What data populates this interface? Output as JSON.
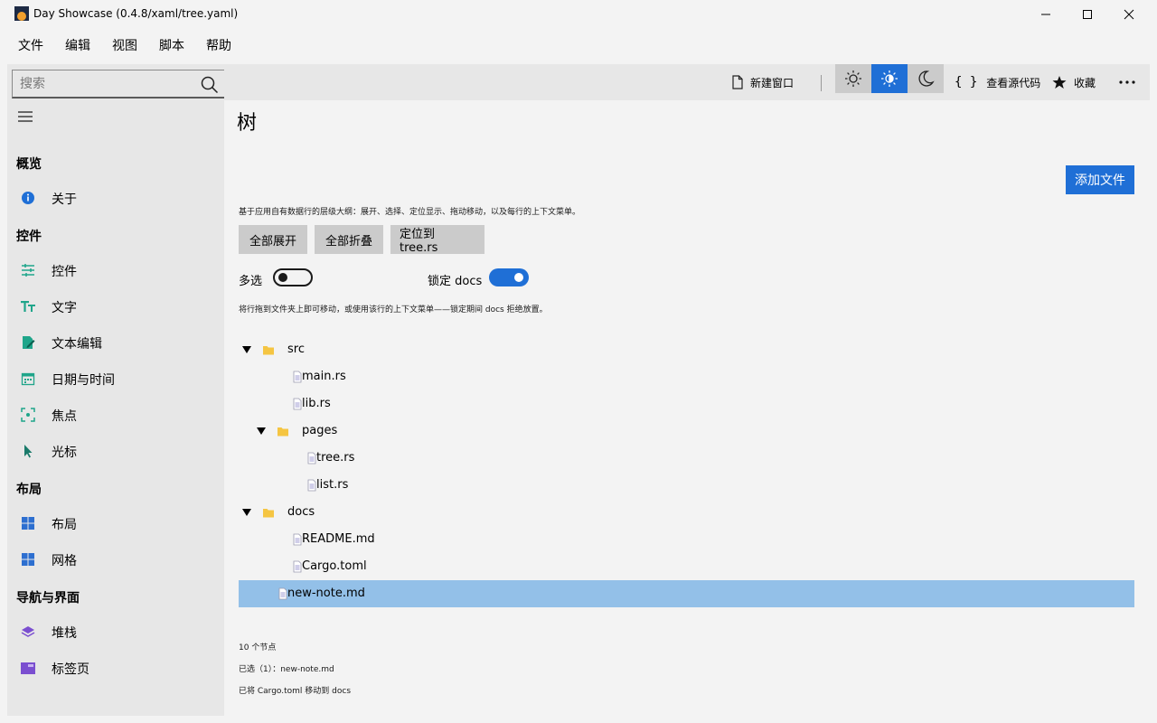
{
  "window": {
    "title": "Day Showcase (0.4.8/xaml/tree.yaml)"
  },
  "menu": [
    "文件",
    "编辑",
    "视图",
    "脚本",
    "帮助"
  ],
  "sidebar": {
    "search_placeholder": "搜索",
    "sections": [
      {
        "title": "概览",
        "items": [
          {
            "label": "关于",
            "icon": "info-icon"
          }
        ]
      },
      {
        "title": "控件",
        "items": [
          {
            "label": "控件",
            "icon": "sliders-icon"
          },
          {
            "label": "文字",
            "icon": "text-icon"
          },
          {
            "label": "文本编辑",
            "icon": "edit-icon"
          },
          {
            "label": "日期与时间",
            "icon": "calendar-icon"
          },
          {
            "label": "焦点",
            "icon": "focus-icon"
          },
          {
            "label": "光标",
            "icon": "cursor-icon"
          }
        ]
      },
      {
        "title": "布局",
        "items": [
          {
            "label": "布局",
            "icon": "layout-icon"
          },
          {
            "label": "网格",
            "icon": "grid-icon"
          }
        ]
      },
      {
        "title": "导航与界面",
        "items": [
          {
            "label": "堆栈",
            "icon": "stack-icon"
          },
          {
            "label": "标签页",
            "icon": "tabs-icon"
          }
        ]
      }
    ]
  },
  "toolbar": {
    "new_window": "新建窗口",
    "view_source": "查看源代码",
    "favorite": "收藏",
    "theme_active": "auto",
    "accent": "#1f6fd6"
  },
  "main": {
    "title": "树",
    "add_file": "添加文件",
    "description": "基于应用自有数据行的层级大纲：展开、选择、定位显示、拖动移动，以及每行的上下文菜单。",
    "buttons": {
      "expand_all": "全部展开",
      "collapse_all": "全部折叠",
      "locate": "定位到 tree.rs"
    },
    "multi_select": {
      "label": "多选",
      "on": false
    },
    "lock_docs": {
      "label": "锁定 docs",
      "on": true
    },
    "hint": "将行拖到文件夹上即可移动，或使用该行的上下文菜单——锁定期间 docs 拒绝放置。",
    "tree": [
      {
        "label": "src",
        "type": "folder",
        "expanded": true,
        "depth": 0
      },
      {
        "label": "main.rs",
        "type": "file",
        "depth": 1
      },
      {
        "label": "lib.rs",
        "type": "file",
        "depth": 1
      },
      {
        "label": "pages",
        "type": "folder",
        "expanded": true,
        "depth": 1
      },
      {
        "label": "tree.rs",
        "type": "file",
        "depth": 2
      },
      {
        "label": "list.rs",
        "type": "file",
        "depth": 2
      },
      {
        "label": "docs",
        "type": "folder",
        "expanded": true,
        "depth": 0
      },
      {
        "label": "README.md",
        "type": "file",
        "depth": 1
      },
      {
        "label": "Cargo.toml",
        "type": "file",
        "depth": 1
      },
      {
        "label": "new-note.md",
        "type": "file",
        "depth": 0,
        "selected": true
      }
    ],
    "status": {
      "count": "10 个节点",
      "selected": "已选（1）：new-note.md",
      "moved": "已将 Cargo.toml 移动到 docs"
    }
  }
}
